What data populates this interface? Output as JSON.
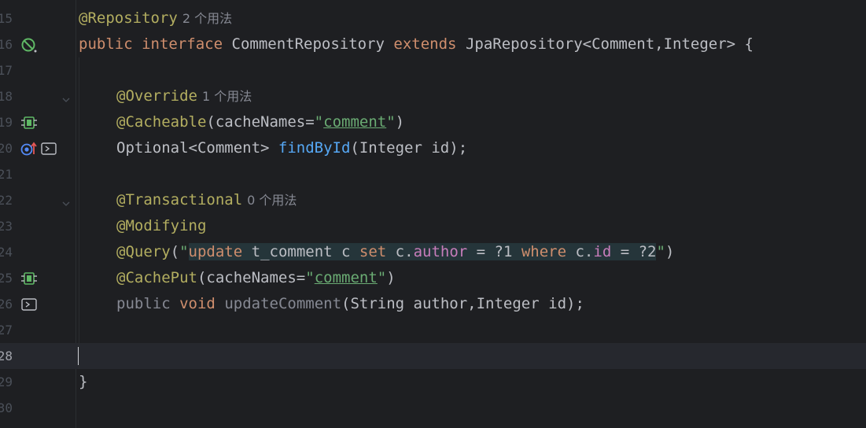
{
  "editor": {
    "lines": [
      {
        "num": "15",
        "hint": "2 个用法"
      },
      {
        "num": "16"
      },
      {
        "num": "17"
      },
      {
        "num": "18",
        "hint": "1 个用法"
      },
      {
        "num": "19"
      },
      {
        "num": "20"
      },
      {
        "num": "21"
      },
      {
        "num": "22",
        "hint": "0 个用法"
      },
      {
        "num": "23"
      },
      {
        "num": "24"
      },
      {
        "num": "25"
      },
      {
        "num": "26"
      },
      {
        "num": "27"
      },
      {
        "num": "28"
      },
      {
        "num": "29"
      },
      {
        "num": "30"
      }
    ],
    "tokens": {
      "l15_ann": "@Repository",
      "l16_public": "public",
      "l16_interface": "interface",
      "l16_name": "CommentRepository",
      "l16_extends": "extends",
      "l16_rest": "JpaRepository<Comment,Integer> {",
      "l18_ann": "@Override",
      "l19_ann": "@Cacheable",
      "l19_open": "(cacheNames=",
      "l19_q1": "\"",
      "l19_str": "comment",
      "l19_q2": "\"",
      "l19_close": ")",
      "l20_type": "Optional<Comment> ",
      "l20_fn": "findById",
      "l20_rest": "(Integer id);",
      "l22_ann": "@Transactional",
      "l23_ann": "@Modifying",
      "l24_ann": "@Query",
      "l24_open": "(",
      "l24_q1": "\"",
      "l24_update": "update",
      "l24_table": " t_comment c ",
      "l24_set": "set",
      "l24_c1": " c.",
      "l24_author": "author",
      "l24_eq1": " = ?1 ",
      "l24_where": "where",
      "l24_c2": " c.",
      "l24_id": "id",
      "l24_eq2": " = ?2",
      "l24_q2": "\"",
      "l24_close": ")",
      "l25_ann": "@CachePut",
      "l25_open": "(cacheNames=",
      "l25_q1": "\"",
      "l25_str": "comment",
      "l25_q2": "\"",
      "l25_close": ")",
      "l26_public": "public",
      "l26_void": "void",
      "l26_fn": "updateComment",
      "l26_rest": "(String author,Integer id);",
      "l29_brace": "}"
    },
    "colors": {
      "background": "#1e1f22",
      "keyword": "#cf8e6d",
      "annotation": "#b3ae60",
      "string": "#6aab73",
      "function": "#56a8f5",
      "field": "#c77dbb",
      "current_line": "#26282e"
    }
  }
}
